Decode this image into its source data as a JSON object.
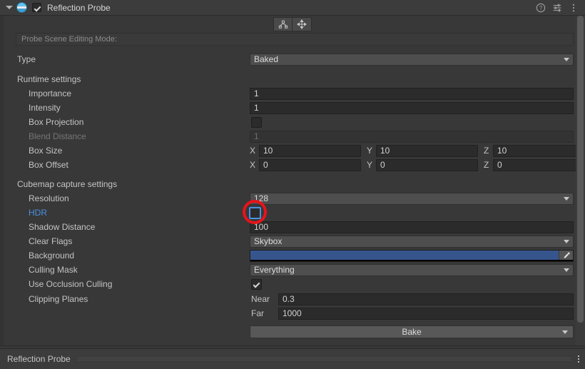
{
  "window": {
    "title": "Reflection Probe",
    "enabled": true,
    "foldout_expanded": true,
    "icons": {
      "foldout": "chevron-down-icon",
      "component": "reflection-probe-sphere-icon",
      "help": "help-icon",
      "settings": "preset-settings-icon",
      "menu": "kebab-menu-icon"
    }
  },
  "toolbar": {
    "buttons": [
      {
        "name": "edit-bounds-button",
        "icon": "probe-bounds-icon"
      },
      {
        "name": "edit-origin-button",
        "icon": "move-arrows-icon"
      }
    ]
  },
  "helpbox": {
    "text": "Probe Scene Editing Mode:"
  },
  "type_row": {
    "label": "Type",
    "value": "Baked"
  },
  "runtime_settings": {
    "header": "Runtime settings",
    "importance": {
      "label": "Importance",
      "value": "1"
    },
    "intensity": {
      "label": "Intensity",
      "value": "1"
    },
    "box_projection": {
      "label": "Box Projection",
      "checked": false
    },
    "blend_distance": {
      "label": "Blend Distance",
      "value": "1",
      "disabled": true
    },
    "box_size": {
      "label": "Box Size",
      "x_axis": "X",
      "x": "10",
      "y_axis": "Y",
      "y": "10",
      "z_axis": "Z",
      "z": "10"
    },
    "box_offset": {
      "label": "Box Offset",
      "x_axis": "X",
      "x": "0",
      "y_axis": "Y",
      "y": "0",
      "z_axis": "Z",
      "z": "0"
    }
  },
  "cubemap_settings": {
    "header": "Cubemap capture settings",
    "resolution": {
      "label": "Resolution",
      "value": "128"
    },
    "hdr": {
      "label": "HDR",
      "checked": false,
      "highlighted": true
    },
    "shadow_distance": {
      "label": "Shadow Distance",
      "value": "100"
    },
    "clear_flags": {
      "label": "Clear Flags",
      "value": "Skybox"
    },
    "background": {
      "label": "Background",
      "color": "#36558c",
      "eyedropper": "eyedropper-icon"
    },
    "culling_mask": {
      "label": "Culling Mask",
      "value": "Everything"
    },
    "use_occlusion_culling": {
      "label": "Use Occlusion Culling",
      "checked": true
    },
    "clipping_planes": {
      "label": "Clipping Planes",
      "near_label": "Near",
      "near": "0.3",
      "far_label": "Far",
      "far": "1000"
    }
  },
  "bake": {
    "label": "Bake"
  },
  "footer": {
    "label": "Reflection Probe",
    "menu_icon": "kebab-menu-icon"
  },
  "annotation": {
    "target": "hdr-checkbox",
    "color": "#e8131a"
  }
}
